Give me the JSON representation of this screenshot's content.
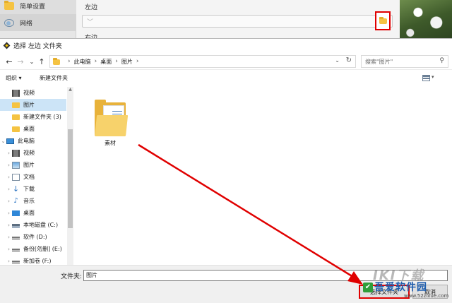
{
  "background_app": {
    "sidebar_items": [
      {
        "label": "简单设置",
        "icon": "folder-icon"
      },
      {
        "label": "网络",
        "icon": "network-icon"
      }
    ],
    "label_left": "左边",
    "label_right": "右边",
    "browse_icon": "folder-icon"
  },
  "dialog": {
    "title": "选择 左边 文件夹",
    "nav": {
      "back": "←",
      "forward": "→",
      "recent": "⌄",
      "up": "↑"
    },
    "breadcrumbs": [
      "此电脑",
      "桌面",
      "图片"
    ],
    "breadcrumb_sep": "›",
    "address_dropdown": "⌄",
    "refresh": "↻",
    "search_placeholder": "搜索\"图片\"",
    "commands": {
      "organize": "组织 ▾",
      "new_folder": "新建文件夹"
    },
    "tree": [
      {
        "label": "视频",
        "icon": "video",
        "indent": 1,
        "expander": ""
      },
      {
        "label": "图片",
        "icon": "folder",
        "indent": 1,
        "expander": "",
        "selected": true
      },
      {
        "label": "新建文件夹 (3)",
        "icon": "folder",
        "indent": 1,
        "expander": ""
      },
      {
        "label": "桌面",
        "icon": "folder",
        "indent": 1,
        "expander": ""
      },
      {
        "label": "此电脑",
        "icon": "pc",
        "indent": 0,
        "expander": "⌄"
      },
      {
        "label": "视频",
        "icon": "video",
        "indent": 1,
        "expander": "›"
      },
      {
        "label": "图片",
        "icon": "pic",
        "indent": 1,
        "expander": "›"
      },
      {
        "label": "文档",
        "icon": "doc",
        "indent": 1,
        "expander": "›"
      },
      {
        "label": "下载",
        "icon": "down",
        "indent": 1,
        "expander": "›"
      },
      {
        "label": "音乐",
        "icon": "music",
        "indent": 1,
        "expander": "›"
      },
      {
        "label": "桌面",
        "icon": "desk",
        "indent": 1,
        "expander": "›"
      },
      {
        "label": "本地磁盘 (C:)",
        "icon": "drive",
        "indent": 1,
        "expander": "›"
      },
      {
        "label": "软件 (D:)",
        "icon": "drive2",
        "indent": 1,
        "expander": "›"
      },
      {
        "label": "备份[勿删] (E:)",
        "icon": "drive2",
        "indent": 1,
        "expander": "›"
      },
      {
        "label": "新加卷 (F:)",
        "icon": "drive2",
        "indent": 1,
        "expander": "›"
      }
    ],
    "files": [
      {
        "label": "素材",
        "icon": "folder-with-documents-icon"
      }
    ],
    "folder_label": "文件夹:",
    "folder_value": "图片",
    "select_folder_button": "选择文件夹",
    "cancel_button": "取消"
  },
  "watermark": {
    "logo_text": "IKI下载",
    "site_name": "吾爱软件园",
    "url": "www.52zixue.com"
  },
  "annotation": {
    "color": "#e00000"
  }
}
